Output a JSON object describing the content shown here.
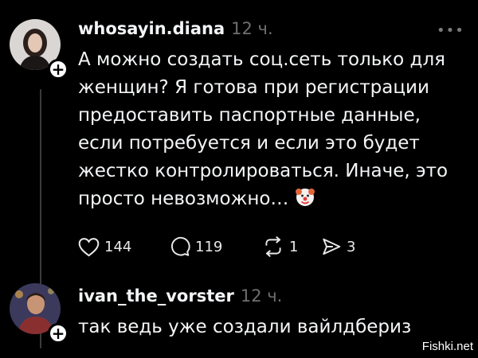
{
  "post1": {
    "username": "whosayin.diana",
    "time": "12 ч.",
    "text": "А можно создать соц.сеть только для женщин? Я готова при регистрации предоставить паспортные данные, если потребуется и если это будет жестко контролироваться. Иначе, это просто невозможно…",
    "emoji": "clown-face-emoji",
    "likes": "144",
    "replies": "119",
    "reposts": "1",
    "shares": "3"
  },
  "post2": {
    "username": "ivan_the_vorster",
    "time": "12 ч.",
    "text": "так ведь уже создали вайлдбериз"
  },
  "icons": {
    "more": "more-icon",
    "like": "heart-icon",
    "reply": "comment-icon",
    "repost": "repost-icon",
    "share": "send-icon",
    "follow": "plus-icon"
  },
  "watermark": "Fishki.net",
  "colors": {
    "background": "#000000",
    "text": "#f3f5f7",
    "secondary": "#6f6f6f",
    "thread_line": "#3a3a3a"
  }
}
